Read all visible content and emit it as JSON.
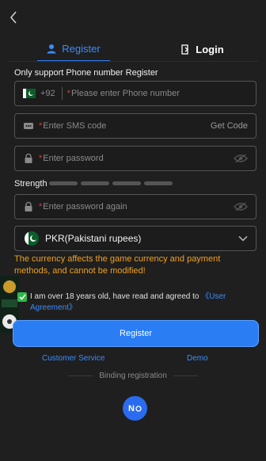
{
  "nav": {
    "back_icon": "chevron-left-icon"
  },
  "tabs": [
    {
      "label": "Register",
      "icon": "user-icon",
      "active": true
    },
    {
      "label": "Login",
      "icon": "login-icon",
      "active": false
    }
  ],
  "form": {
    "note": "Only support Phone number Register",
    "phone": {
      "country_code": "+92",
      "placeholder": "Please enter Phone number",
      "required_mark": "*"
    },
    "sms": {
      "placeholder": "Enter SMS code",
      "required_mark": "*",
      "get_code_label": "Get Code"
    },
    "password": {
      "placeholder": "Enter password",
      "required_mark": "*"
    },
    "strength_label": "Strength",
    "password_again": {
      "placeholder": "Enter password again",
      "required_mark": "*"
    },
    "currency": {
      "selected": "PKR(Pakistani rupees)"
    },
    "currency_warning": "The currency affects the game currency and payment methods, and cannot be modified!",
    "agreement": {
      "text": "I am over 18 years old, have read and agreed to ",
      "link": "《User Agreement》",
      "checked": true
    },
    "register_button": "Register"
  },
  "footer": {
    "customer_service": "Customer Service",
    "demo": "Demo",
    "binding_label": "Binding registration",
    "binding_button": "N"
  },
  "colors": {
    "accent": "#2a7df3",
    "warning": "#f0a020",
    "required": "#e03b3b",
    "check": "#2fb84a"
  }
}
